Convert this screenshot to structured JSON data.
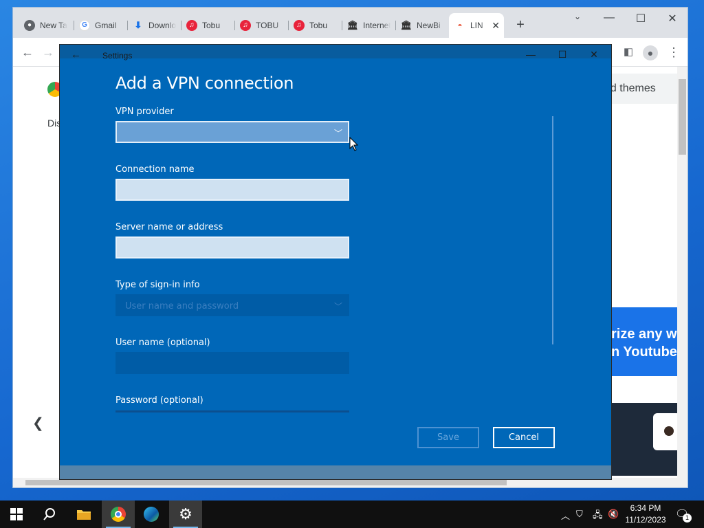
{
  "browser": {
    "tabs": [
      {
        "title": "New Tab",
        "icon": "chrome-icon",
        "color": "#5f6368"
      },
      {
        "title": "Gmail",
        "icon": "google-g-icon",
        "color": "#4285f4"
      },
      {
        "title": "Downloads",
        "icon": "download-icon",
        "color": "#1a73e8"
      },
      {
        "title": "Tobu",
        "icon": "music-note-icon",
        "color": "#e8233b"
      },
      {
        "title": "TOBU",
        "icon": "music-note-icon",
        "color": "#e8233b"
      },
      {
        "title": "Tobu",
        "icon": "music-note-icon",
        "color": "#e8233b"
      },
      {
        "title": "Internet",
        "icon": "archive-icon",
        "color": "#444444"
      },
      {
        "title": "NewBi",
        "icon": "archive-icon",
        "color": "#444444"
      }
    ],
    "active_tab": {
      "title": "LIN",
      "icon": "rainbow-icon"
    },
    "new_tab_label": "+",
    "page": {
      "themes_text": "nd themes",
      "left_text": "Dis",
      "promo_text_line1": "rize any w",
      "promo_text_line2": "n Youtube"
    }
  },
  "settings_window": {
    "title": "Settings",
    "dialog": {
      "title": "Add a VPN connection",
      "fields": {
        "vpn_provider": {
          "label": "VPN provider",
          "value": ""
        },
        "connection_name": {
          "label": "Connection name",
          "value": ""
        },
        "server": {
          "label": "Server name or address",
          "value": ""
        },
        "signin_type": {
          "label": "Type of sign-in info",
          "value": "User name and password"
        },
        "username": {
          "label": "User name (optional)",
          "value": ""
        },
        "password": {
          "label": "Password (optional)",
          "value": ""
        }
      },
      "save_label": "Save",
      "cancel_label": "Cancel"
    }
  },
  "taskbar": {
    "time": "6:34 PM",
    "date": "11/12/2023",
    "notification_count": "1"
  },
  "colors": {
    "settings_blue": "#0067b8",
    "taskbar": "#101010",
    "desktop": "#1b6fd6"
  }
}
